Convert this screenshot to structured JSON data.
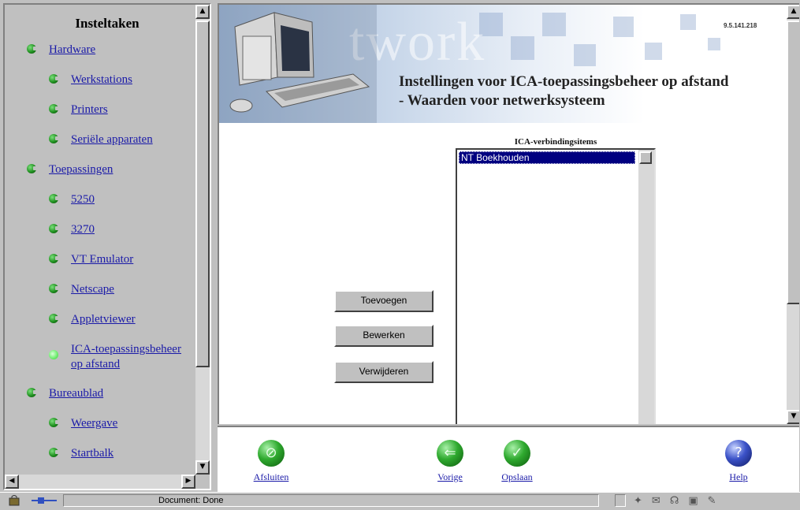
{
  "nav": {
    "title": "Insteltaken",
    "items": [
      {
        "label": "Hardware",
        "level": 0,
        "state": "normal"
      },
      {
        "label": "Werkstations",
        "level": 1,
        "state": "normal"
      },
      {
        "label": "Printers",
        "level": 1,
        "state": "normal"
      },
      {
        "label": "Seriële apparaten",
        "level": 1,
        "state": "normal"
      },
      {
        "label": "Toepassingen",
        "level": 0,
        "state": "normal"
      },
      {
        "label": "5250",
        "level": 1,
        "state": "normal"
      },
      {
        "label": "3270",
        "level": 1,
        "state": "normal"
      },
      {
        "label": "VT Emulator",
        "level": 1,
        "state": "normal"
      },
      {
        "label": "Netscape",
        "level": 1,
        "state": "normal"
      },
      {
        "label": "Appletviewer",
        "level": 1,
        "state": "normal"
      },
      {
        "label": "ICA-toepassingsbeheer op afstand",
        "level": 1,
        "state": "active"
      },
      {
        "label": "Bureaublad",
        "level": 0,
        "state": "normal"
      },
      {
        "label": "Weergave",
        "level": 1,
        "state": "normal"
      },
      {
        "label": "Startbalk",
        "level": 1,
        "state": "normal"
      }
    ]
  },
  "main": {
    "ip_address": "9.5.141.218",
    "title_line1": "Instellingen voor ICA-toepassingsbeheer op afstand",
    "title_line2": "- Waarden voor netwerksysteem",
    "banner_watermark": "twork",
    "list_caption": "ICA-verbindingsitems",
    "list_items": [
      {
        "label": "NT Boekhouden",
        "selected": true
      }
    ],
    "buttons": {
      "add": "Toevoegen",
      "edit": "Bewerken",
      "delete": "Verwijderen"
    }
  },
  "toolbar": {
    "close": "Afsluiten",
    "back": "Vorige",
    "save": "Opslaan",
    "help": "Help"
  },
  "status_bar": {
    "text": "Document: Done"
  },
  "colors": {
    "link": "#1a1aa8",
    "selection": "#000080",
    "chrome": "#c0c0c0"
  }
}
